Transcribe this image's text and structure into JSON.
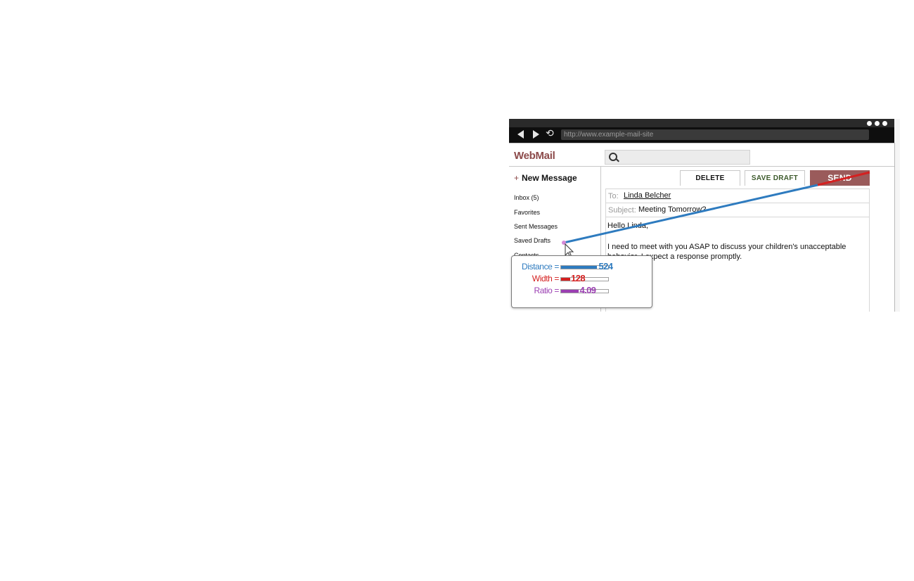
{
  "browser": {
    "url": "http://www.example-mail-site",
    "menu_icon": "three-dots-icon",
    "back_icon": "back-arrow-icon",
    "forward_icon": "forward-arrow-icon",
    "reload_icon": "reload-icon"
  },
  "app": {
    "brand": "WebMail",
    "search_icon": "magnifier-icon",
    "search_placeholder": ""
  },
  "sidebar": {
    "new_message_plus": "+",
    "new_message": "New Message",
    "items": [
      {
        "label": "Inbox (5)"
      },
      {
        "label": "Favorites"
      },
      {
        "label": "Sent Messages"
      },
      {
        "label": "Saved Drafts"
      },
      {
        "label": "Contacts"
      }
    ]
  },
  "toolbar": {
    "delete": "DELETE",
    "save_draft": "SAVE DRAFT",
    "send": "SEND"
  },
  "compose": {
    "to_label": "To:",
    "to_value": "Linda Belcher",
    "subject_label": "Subject:",
    "subject_value": "Meeting Tomorrow?",
    "body_line1": "Hello Linda,",
    "body_line2": "I need to meet with you ASAP to discuss your children's unacceptable",
    "body_line3": "behavior. I expect a response promptly."
  },
  "fitts_overlay": {
    "distance_label": "Distance =",
    "distance_value": "524",
    "distance_fraction": 0.76,
    "width_label": "Width =",
    "width_value": "128",
    "width_fraction": 0.19,
    "ratio_label": "Ratio =",
    "ratio_value": "4.09",
    "ratio_fraction": 0.37,
    "colors": {
      "distance": "#2e7bbf",
      "width": "#d42020",
      "ratio": "#9b3fb2"
    }
  },
  "colors": {
    "brand": "#8c4a4a",
    "send_button": "#9a5b5b",
    "save_draft_text": "#3d5a2c",
    "chrome": "#0e0e0e"
  }
}
